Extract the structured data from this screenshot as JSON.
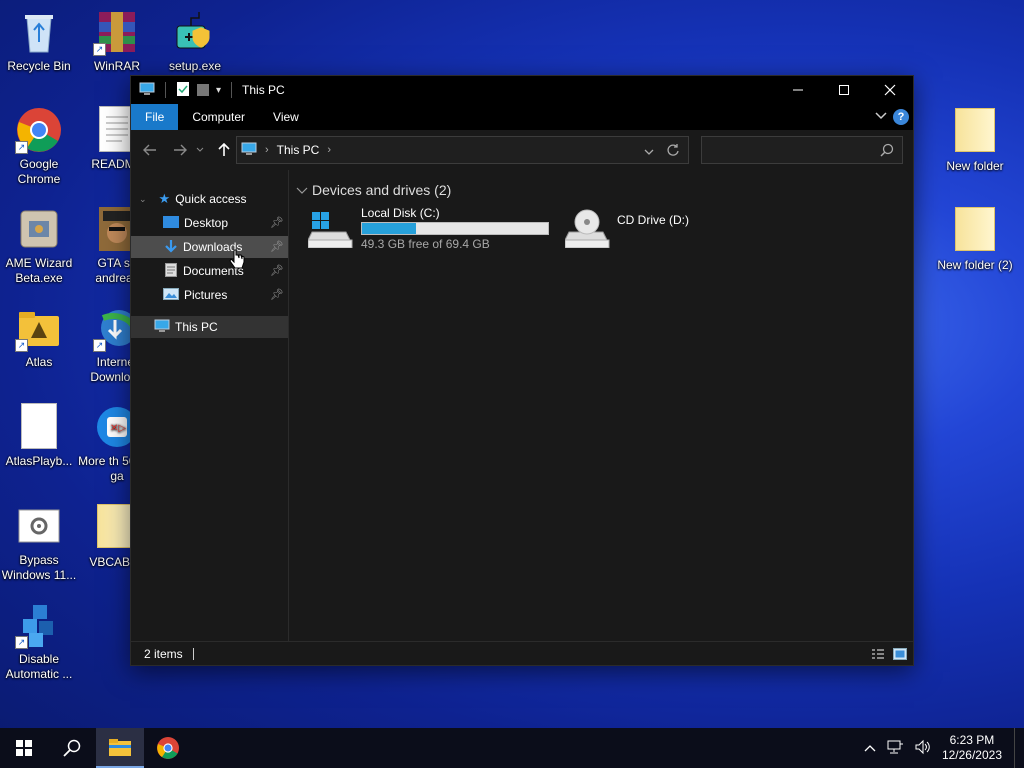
{
  "desktop": {
    "icons": [
      {
        "label": "Recycle Bin"
      },
      {
        "label": "WinRAR"
      },
      {
        "label": "setup.exe"
      },
      {
        "label": "Google Chrome"
      },
      {
        "label": "README"
      },
      {
        "label": "AME Wizard Beta.exe"
      },
      {
        "label": "GTA sa andreas"
      },
      {
        "label": "Atlas"
      },
      {
        "label": "Internet Download"
      },
      {
        "label": "AtlasPlayb..."
      },
      {
        "label": "More th 5000+ ga"
      },
      {
        "label": "Bypass Windows 11..."
      },
      {
        "label": "VBCABLE"
      },
      {
        "label": "Disable Automatic ..."
      },
      {
        "label": "New folder"
      },
      {
        "label": "New folder (2)"
      }
    ]
  },
  "window": {
    "title": "This PC",
    "ribbon_tabs": [
      "File",
      "Computer",
      "View"
    ],
    "address": {
      "segment": "This PC"
    },
    "search": {
      "placeholder": ""
    },
    "sidebar": {
      "quick_access": "Quick access",
      "items": [
        "Desktop",
        "Downloads",
        "Documents",
        "Pictures"
      ],
      "this_pc": "This PC"
    },
    "content": {
      "group_header": "Devices and drives (2)",
      "drives": [
        {
          "name": "Local Disk (C:)",
          "free_text": "49.3 GB free of 69.4 GB",
          "used_fraction": 0.29
        },
        {
          "name": "CD Drive (D:)"
        }
      ]
    },
    "status": {
      "items": "2 items"
    }
  },
  "taskbar": {
    "time": "6:23 PM",
    "date": "12/26/2023"
  },
  "colors": {
    "accent": "#1979ca",
    "drive_bar": "#26a0da"
  }
}
